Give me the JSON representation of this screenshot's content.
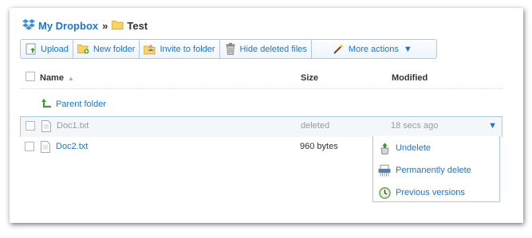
{
  "breadcrumb": {
    "root": "My Dropbox",
    "separator": "»",
    "current": "Test"
  },
  "toolbar": {
    "upload": "Upload",
    "new_folder": "New folder",
    "invite": "Invite to folder",
    "hide_deleted": "Hide deleted files",
    "more_actions": "More actions"
  },
  "table": {
    "headers": {
      "name": "Name",
      "size": "Size",
      "modified": "Modified"
    },
    "parent_folder": "Parent folder",
    "rows": [
      {
        "name": "Doc1.txt",
        "size": "deleted",
        "modified": "18 secs ago"
      },
      {
        "name": "Doc2.txt",
        "size": "960 bytes",
        "modified": ""
      }
    ]
  },
  "menu": {
    "items": [
      {
        "label": "Undelete",
        "icon": "undelete-icon"
      },
      {
        "label": "Permanently delete",
        "icon": "shredder-icon"
      },
      {
        "label": "Previous versions",
        "icon": "clock-icon"
      }
    ]
  },
  "colors": {
    "link": "#1f75cc",
    "border": "#a9c9e8"
  }
}
